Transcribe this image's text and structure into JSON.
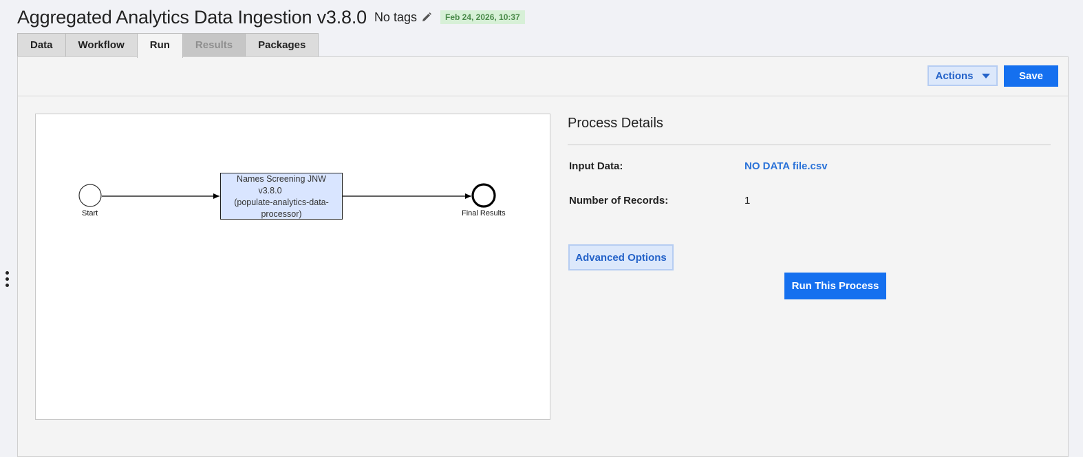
{
  "header": {
    "title": "Aggregated Analytics Data Ingestion v3.8.0",
    "tags_text": "No tags",
    "date_badge": "Feb 24, 2026, 10:37"
  },
  "tabs": [
    {
      "label": "Data",
      "state": "normal"
    },
    {
      "label": "Workflow",
      "state": "normal"
    },
    {
      "label": "Run",
      "state": "active"
    },
    {
      "label": "Results",
      "state": "disabled"
    },
    {
      "label": "Packages",
      "state": "normal"
    }
  ],
  "toolbar": {
    "actions_label": "Actions",
    "save_label": "Save"
  },
  "diagram": {
    "start_label": "Start",
    "task_lines": [
      "Names Screening JNW",
      "v3.8.0",
      "(populate-analytics-data-",
      "processor)"
    ],
    "end_label": "Final Results"
  },
  "details": {
    "title": "Process Details",
    "input_data_label": "Input Data:",
    "input_data_value": "NO DATA file.csv",
    "records_label": "Number of Records:",
    "records_value": "1",
    "advanced_label": "Advanced Options",
    "run_label": "Run This Process"
  },
  "colors": {
    "primary": "#1570ef",
    "secondary_bg": "#dce8fb",
    "link": "#2a72d8",
    "badge_bg": "#d7f0d7",
    "task_fill": "#d9e5ff"
  },
  "icons": {
    "edit": "pencil-icon",
    "actions_caret": "caret-down-icon",
    "handle": "vertical-dots-icon"
  }
}
